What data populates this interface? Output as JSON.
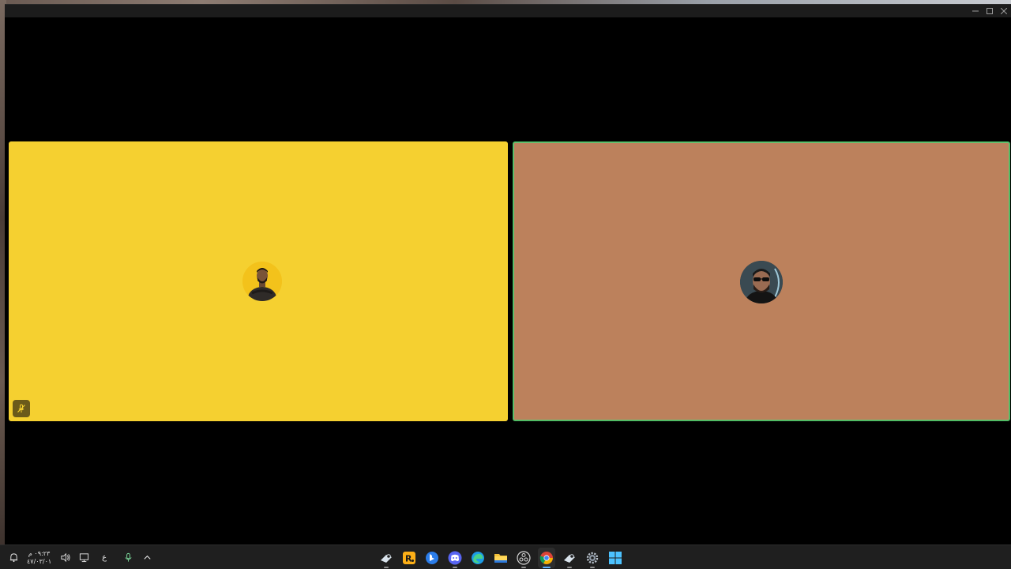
{
  "window": {
    "controls": [
      "minimize",
      "maximize",
      "close"
    ]
  },
  "tiles": [
    {
      "id": "participant-1",
      "background": "#f5d030",
      "muted": true,
      "speaking": false
    },
    {
      "id": "participant-2",
      "background": "#bc815c",
      "muted": false,
      "speaking": true
    }
  ],
  "taskbar": {
    "clock_time": "٠٩:٢٣ م",
    "clock_date": "٤٧/٠٣/٠١",
    "language": "ع",
    "apps": [
      {
        "name": "steam",
        "running": true
      },
      {
        "name": "rockstar-launcher",
        "running": false
      },
      {
        "name": "bing",
        "running": false
      },
      {
        "name": "discord",
        "running": true
      },
      {
        "name": "edge",
        "running": false
      },
      {
        "name": "file-explorer",
        "running": false
      },
      {
        "name": "obs",
        "running": true
      },
      {
        "name": "chrome",
        "running": true,
        "active": true
      },
      {
        "name": "steam-2",
        "running": true
      },
      {
        "name": "settings",
        "running": true
      },
      {
        "name": "windows-start",
        "running": false
      }
    ]
  },
  "colors": {
    "active_speaker_border": "#3fb95a",
    "taskbar_bg": "#1f1f1f",
    "accent": "#5db0ff"
  }
}
